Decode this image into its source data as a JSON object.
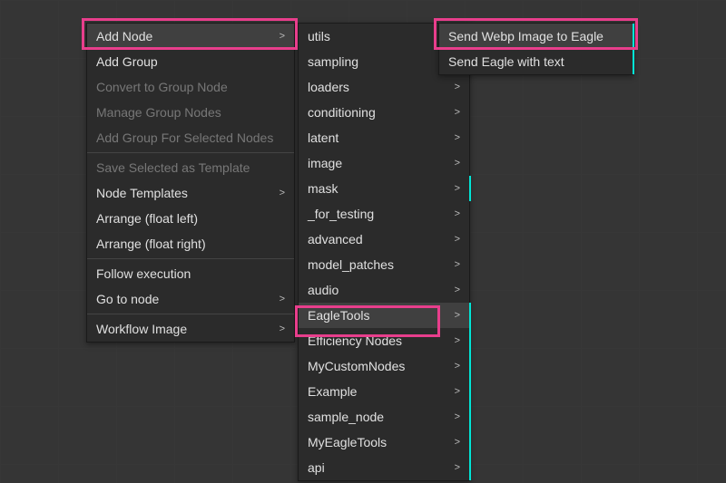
{
  "colors": {
    "accent": "#00e5d6",
    "highlight": "#e83e8c",
    "menu_bg": "#2b2b2b",
    "canvas_bg": "#353535"
  },
  "menu1": {
    "sections": [
      [
        {
          "label": "Add Node",
          "chevron": true,
          "hovered": true
        },
        {
          "label": "Add Group"
        },
        {
          "label": "Convert to Group Node",
          "disabled": true
        },
        {
          "label": "Manage Group Nodes",
          "disabled": true
        },
        {
          "label": "Add Group For Selected Nodes",
          "disabled": true
        }
      ],
      [
        {
          "label": "Save Selected as Template",
          "disabled": true
        },
        {
          "label": "Node Templates",
          "chevron": true
        },
        {
          "label": "Arrange (float left)"
        },
        {
          "label": "Arrange (float right)"
        }
      ],
      [
        {
          "label": "Follow execution"
        },
        {
          "label": "Go to node",
          "chevron": true
        }
      ],
      [
        {
          "label": "Workflow Image",
          "chevron": true
        }
      ]
    ]
  },
  "menu2": {
    "items": [
      {
        "label": "utils",
        "chevron": true
      },
      {
        "label": "sampling",
        "chevron": true,
        "cyan": true
      },
      {
        "label": "loaders",
        "chevron": true
      },
      {
        "label": "conditioning",
        "chevron": true
      },
      {
        "label": "latent",
        "chevron": true
      },
      {
        "label": "image",
        "chevron": true
      },
      {
        "label": "mask",
        "chevron": true,
        "cyan": true
      },
      {
        "label": "_for_testing",
        "chevron": true
      },
      {
        "label": "advanced",
        "chevron": true
      },
      {
        "label": "model_patches",
        "chevron": true
      },
      {
        "label": "audio",
        "chevron": true
      },
      {
        "label": "EagleTools",
        "chevron": true,
        "cyan": true,
        "hovered": true
      },
      {
        "label": "Efficiency Nodes",
        "chevron": true,
        "cyan": true
      },
      {
        "label": "MyCustomNodes",
        "chevron": true,
        "cyan": true
      },
      {
        "label": "Example",
        "chevron": true,
        "cyan": true
      },
      {
        "label": "sample_node",
        "chevron": true,
        "cyan": true
      },
      {
        "label": "MyEagleTools",
        "chevron": true,
        "cyan": true
      },
      {
        "label": "api",
        "chevron": true,
        "cyan": true
      }
    ]
  },
  "menu3": {
    "items": [
      {
        "label": "Send Webp Image to Eagle",
        "cyan": true,
        "hovered": true
      },
      {
        "label": "Send Eagle with text",
        "cyan": true
      }
    ]
  }
}
